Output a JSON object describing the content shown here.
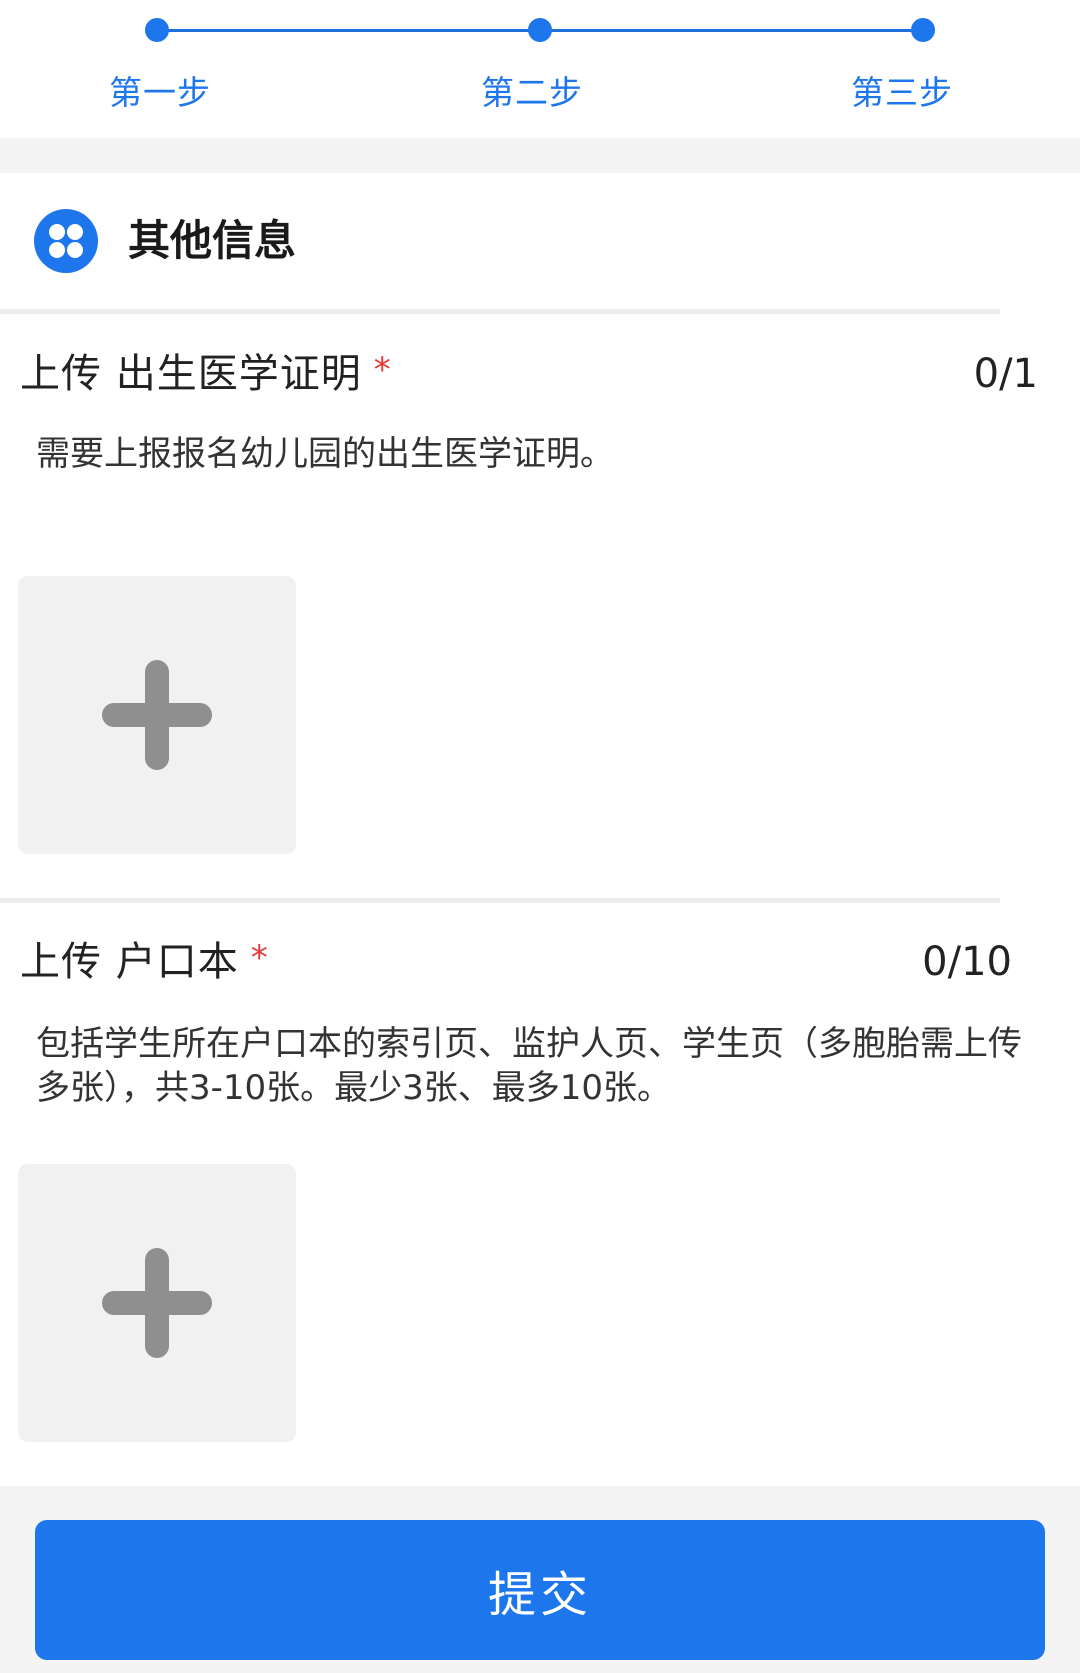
{
  "stepper": {
    "steps": [
      {
        "label": "第一步"
      },
      {
        "label": "第二步"
      },
      {
        "label": "第三步"
      }
    ],
    "color": "#1e76ec"
  },
  "section": {
    "icon": "grid-flower-icon",
    "title": "其他信息"
  },
  "uploads": [
    {
      "title": "上传 出生医学证明",
      "required_mark": "*",
      "count": "0/1",
      "description": "需要上报报名幼儿园的出生医学证明。",
      "add_icon": "plus-icon"
    },
    {
      "title": "上传 户口本",
      "required_mark": "*",
      "count": "0/10",
      "description": "包括学生所在户口本的索引页、监护人页、学生页（多胞胎需上传多张），共3-10张。最少3张、最多10张。",
      "add_icon": "plus-icon"
    }
  ],
  "footer": {
    "submit_label": "提交"
  },
  "colors": {
    "accent": "#1e76ec",
    "required": "#e53935",
    "background_gray": "#f4f4f4"
  }
}
